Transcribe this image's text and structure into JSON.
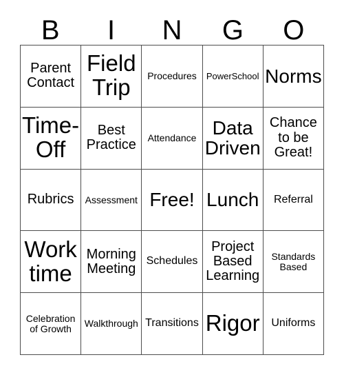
{
  "card": {
    "title": "BINGO",
    "header_letters": [
      "B",
      "I",
      "N",
      "G",
      "O"
    ],
    "columns": 5,
    "rows": 5,
    "grid_color": "#4d4d4d",
    "background_color": "#ffffff",
    "text_color": "#000000",
    "free_space_index": 12,
    "cells": [
      {
        "label": "Parent Contact",
        "size": "md"
      },
      {
        "label": "Field Trip",
        "size": "xxl"
      },
      {
        "label": "Procedures",
        "size": "xs"
      },
      {
        "label": "PowerSchool",
        "size": "xxs"
      },
      {
        "label": "Norms",
        "size": "xl"
      },
      {
        "label": "Time-Off",
        "size": "xxl"
      },
      {
        "label": "Best Practice",
        "size": "md"
      },
      {
        "label": "Attendance",
        "size": "xs"
      },
      {
        "label": "Data Driven",
        "size": "xl"
      },
      {
        "label": "Chance to be Great!",
        "size": "md"
      },
      {
        "label": "Rubrics",
        "size": "md"
      },
      {
        "label": "Assessment",
        "size": "xs"
      },
      {
        "label": "Free!",
        "size": "xl"
      },
      {
        "label": "Lunch",
        "size": "xl"
      },
      {
        "label": "Referral",
        "size": "sm"
      },
      {
        "label": "Work time",
        "size": "xxl"
      },
      {
        "label": "Morning Meeting",
        "size": "md"
      },
      {
        "label": "Schedules",
        "size": "sm"
      },
      {
        "label": "Project Based Learning",
        "size": "md"
      },
      {
        "label": "Standards Based",
        "size": "xs"
      },
      {
        "label": "Celebration of Growth",
        "size": "xs"
      },
      {
        "label": "Walkthrough",
        "size": "xs"
      },
      {
        "label": "Transitions",
        "size": "sm"
      },
      {
        "label": "Rigor",
        "size": "xxl"
      },
      {
        "label": "Uniforms",
        "size": "sm"
      }
    ]
  }
}
